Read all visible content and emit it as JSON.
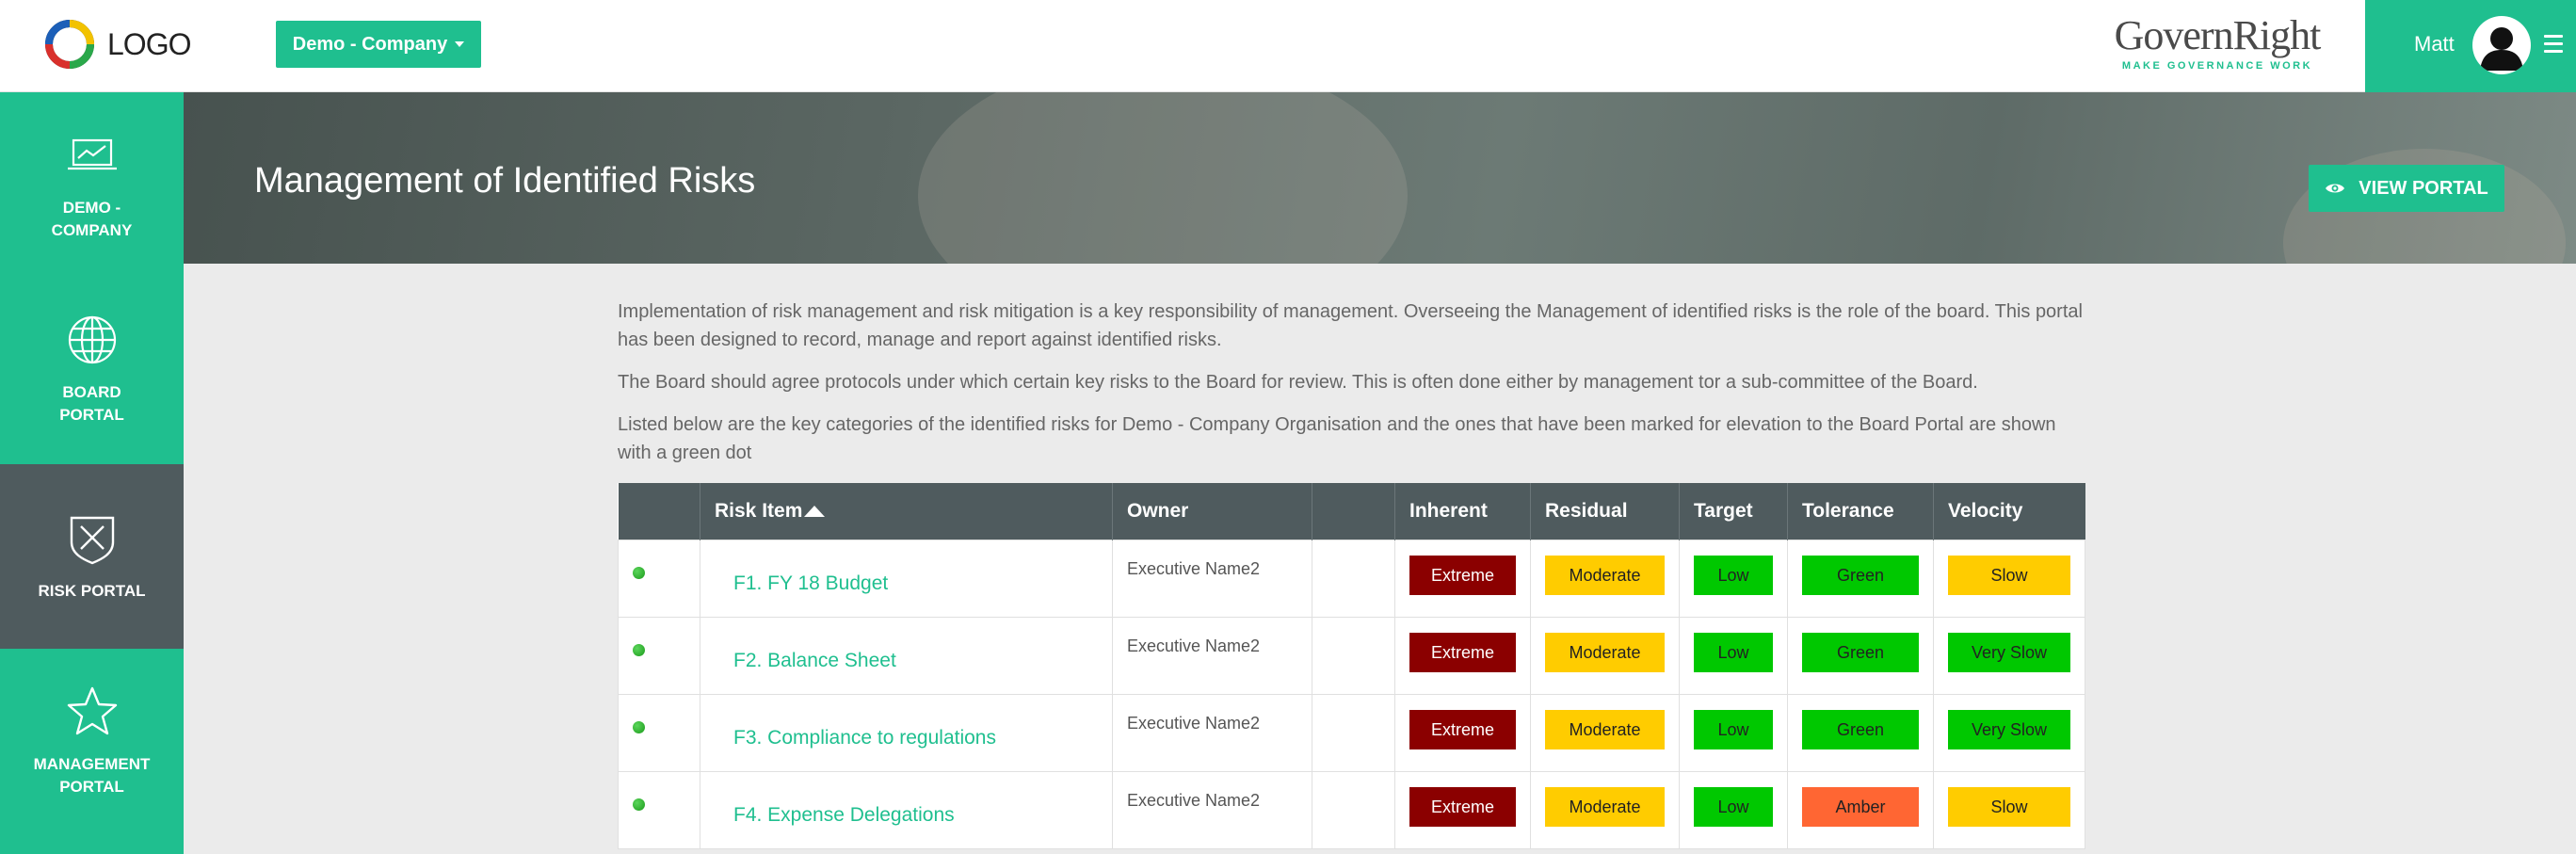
{
  "header": {
    "logo_text": "LOGO",
    "company_selector": "Demo - Company",
    "brand_title": "GovernRight",
    "brand_tagline": "MAKE GOVERNANCE WORK",
    "user_name": "Matt"
  },
  "sidebar": {
    "items": [
      {
        "label": "DEMO -\nCOMPANY",
        "icon": "monitor-chart-icon",
        "active": false
      },
      {
        "label": "BOARD\nPORTAL",
        "icon": "globe-icon",
        "active": false
      },
      {
        "label": "RISK PORTAL",
        "icon": "shield-x-icon",
        "active": true
      },
      {
        "label": "MANAGEMENT\nPORTAL",
        "icon": "star-icon",
        "active": false
      }
    ]
  },
  "hero": {
    "title": "Management of Identified Risks",
    "view_portal_label": "VIEW PORTAL"
  },
  "content": {
    "paragraphs": [
      "Implementation of risk management and risk mitigation is a key responsibility of management. Overseeing the Management of identified risks is the role of the board. This portal has been designed to record, manage and report against identified risks.",
      "The Board should agree protocols under which certain key risks to the Board for review. This is often done either by management tor a sub-committee of the Board.",
      "Listed below are the key categories of the identified risks for Demo - Company Organisation and the ones that have been marked for elevation to the Board Portal are shown with a green dot"
    ]
  },
  "table": {
    "headers": [
      "",
      "Risk Item",
      "Owner",
      "",
      "Inherent",
      "Residual",
      "Target",
      "Tolerance",
      "Velocity"
    ],
    "rows": [
      {
        "item": "F1. FY 18 Budget",
        "owner": "Executive Name2",
        "inherent": "Extreme",
        "residual": "Moderate",
        "target": "Low",
        "tolerance": "Green",
        "velocity": "Slow"
      },
      {
        "item": "F2. Balance Sheet",
        "owner": "Executive Name2",
        "inherent": "Extreme",
        "residual": "Moderate",
        "target": "Low",
        "tolerance": "Green",
        "velocity": "Very Slow"
      },
      {
        "item": "F3. Compliance to regulations",
        "owner": "Executive Name2",
        "inherent": "Extreme",
        "residual": "Moderate",
        "target": "Low",
        "tolerance": "Green",
        "velocity": "Very Slow"
      },
      {
        "item": "F4. Expense Delegations",
        "owner": "Executive Name2",
        "inherent": "Extreme",
        "residual": "Moderate",
        "target": "Low",
        "tolerance": "Amber",
        "velocity": "Slow"
      }
    ]
  },
  "colors": {
    "brand_green": "#1fbf8f",
    "dark_slate": "#4f5b5e",
    "extreme": "#8b0000",
    "moderate": "#ffcc00",
    "low_green": "#00c800",
    "amber": "#ff6633"
  }
}
